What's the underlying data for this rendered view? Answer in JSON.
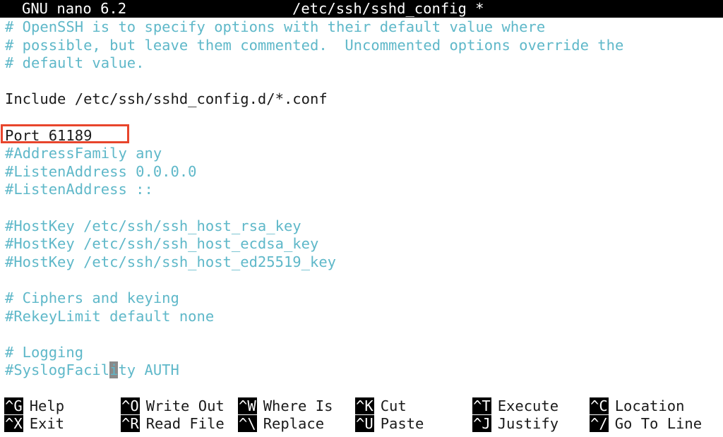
{
  "titlebar": {
    "app_name": "GNU nano 6.2",
    "file_name": "/etc/ssh/sshd_config *"
  },
  "editor": {
    "lines": [
      {
        "text": "# OpenSSH is to specify options with their default value where",
        "type": "comment"
      },
      {
        "text": "# possible, but leave them commented.  Uncommented options override the",
        "type": "comment"
      },
      {
        "text": "# default value.",
        "type": "comment"
      },
      {
        "text": "",
        "type": "plain"
      },
      {
        "text": "Include /etc/ssh/sshd_config.d/*.conf",
        "type": "plain"
      },
      {
        "text": "",
        "type": "plain"
      },
      {
        "text": "Port 61189",
        "type": "plain"
      },
      {
        "text": "#AddressFamily any",
        "type": "comment"
      },
      {
        "text": "#ListenAddress 0.0.0.0",
        "type": "comment"
      },
      {
        "text": "#ListenAddress ::",
        "type": "comment"
      },
      {
        "text": "",
        "type": "plain"
      },
      {
        "text": "#HostKey /etc/ssh/ssh_host_rsa_key",
        "type": "comment"
      },
      {
        "text": "#HostKey /etc/ssh/ssh_host_ecdsa_key",
        "type": "comment"
      },
      {
        "text": "#HostKey /etc/ssh/ssh_host_ed25519_key",
        "type": "comment"
      },
      {
        "text": "",
        "type": "plain"
      },
      {
        "text": "# Ciphers and keying",
        "type": "comment"
      },
      {
        "text": "#RekeyLimit default none",
        "type": "comment"
      },
      {
        "text": "",
        "type": "plain"
      },
      {
        "text": "# Logging",
        "type": "comment"
      },
      {
        "text": "#SyslogFacility AUTH",
        "type": "comment",
        "cursor_col": 12
      }
    ],
    "highlighted_line": "Port 61189",
    "highlight_color": "#e8452c",
    "comment_color": "#5fb8c9"
  },
  "shortcuts": {
    "row1": [
      {
        "key": "^G",
        "label": "Help"
      },
      {
        "key": "^O",
        "label": "Write Out"
      },
      {
        "key": "^W",
        "label": "Where Is"
      },
      {
        "key": "^K",
        "label": "Cut"
      },
      {
        "key": "^T",
        "label": "Execute"
      },
      {
        "key": "^C",
        "label": "Location"
      }
    ],
    "row2": [
      {
        "key": "^X",
        "label": "Exit"
      },
      {
        "key": "^R",
        "label": "Read File"
      },
      {
        "key": "^\\",
        "label": "Replace"
      },
      {
        "key": "^U",
        "label": "Paste"
      },
      {
        "key": "^J",
        "label": "Justify"
      },
      {
        "key": "^/",
        "label": "Go To Line"
      }
    ]
  }
}
